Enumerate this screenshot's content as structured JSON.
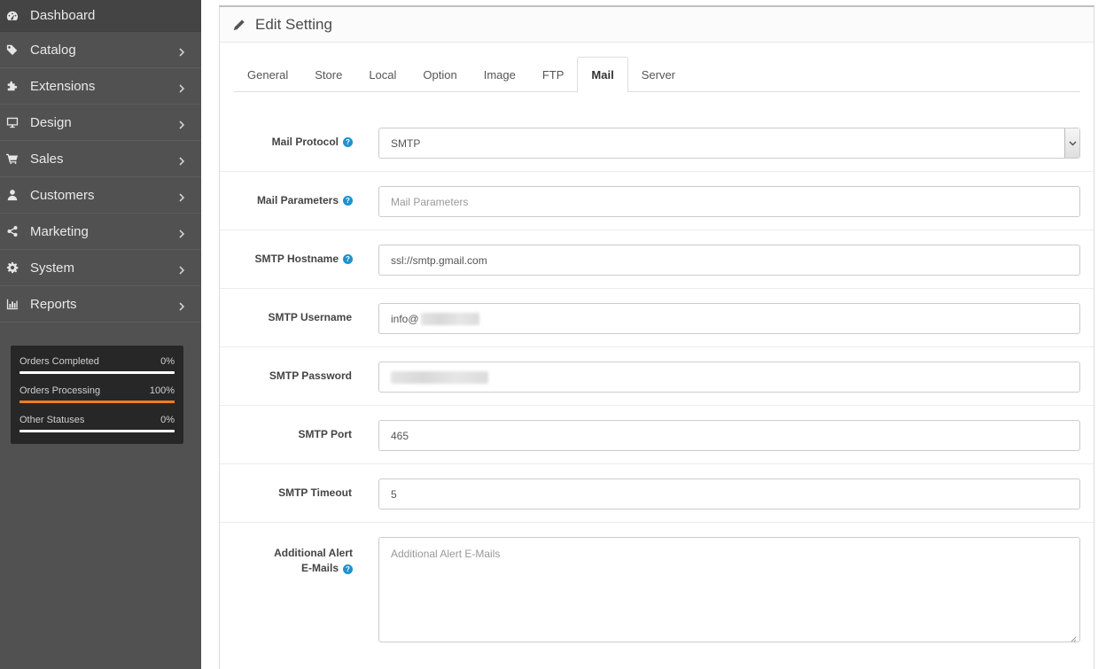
{
  "sidebar": {
    "items": [
      {
        "label": "Dashboard",
        "icon": "dashboard-icon"
      },
      {
        "label": "Catalog",
        "icon": "tags-icon"
      },
      {
        "label": "Extensions",
        "icon": "puzzle-icon"
      },
      {
        "label": "Design",
        "icon": "desktop-icon"
      },
      {
        "label": "Sales",
        "icon": "cart-icon"
      },
      {
        "label": "Customers",
        "icon": "user-icon"
      },
      {
        "label": "Marketing",
        "icon": "share-icon"
      },
      {
        "label": "System",
        "icon": "gear-icon"
      },
      {
        "label": "Reports",
        "icon": "bar-chart-icon"
      }
    ],
    "stats": [
      {
        "label": "Orders Completed",
        "value": "0%",
        "percent": 0
      },
      {
        "label": "Orders Processing",
        "value": "100%",
        "percent": 100
      },
      {
        "label": "Other Statuses",
        "value": "0%",
        "percent": 0
      }
    ]
  },
  "panel": {
    "title": "Edit Setting",
    "tabs": [
      "General",
      "Store",
      "Local",
      "Option",
      "Image",
      "FTP",
      "Mail",
      "Server"
    ],
    "active_tab": "Mail"
  },
  "form": {
    "mail_protocol": {
      "label": "Mail Protocol",
      "value": "SMTP"
    },
    "mail_parameters": {
      "label": "Mail Parameters",
      "placeholder": "Mail Parameters"
    },
    "smtp_hostname": {
      "label": "SMTP Hostname",
      "value": "ssl://smtp.gmail.com"
    },
    "smtp_username": {
      "label": "SMTP Username",
      "value": "info@"
    },
    "smtp_password": {
      "label": "SMTP Password"
    },
    "smtp_port": {
      "label": "SMTP Port",
      "value": "465"
    },
    "smtp_timeout": {
      "label": "SMTP Timeout",
      "value": "5"
    },
    "alert_emails": {
      "label_line1": "Additional Alert",
      "label_line2": "E-Mails",
      "placeholder": "Additional Alert E-Mails"
    }
  },
  "colors": {
    "sidebar_bg": "#515151",
    "accent_orange": "#f07e1a",
    "help_blue": "#1e91cf"
  }
}
